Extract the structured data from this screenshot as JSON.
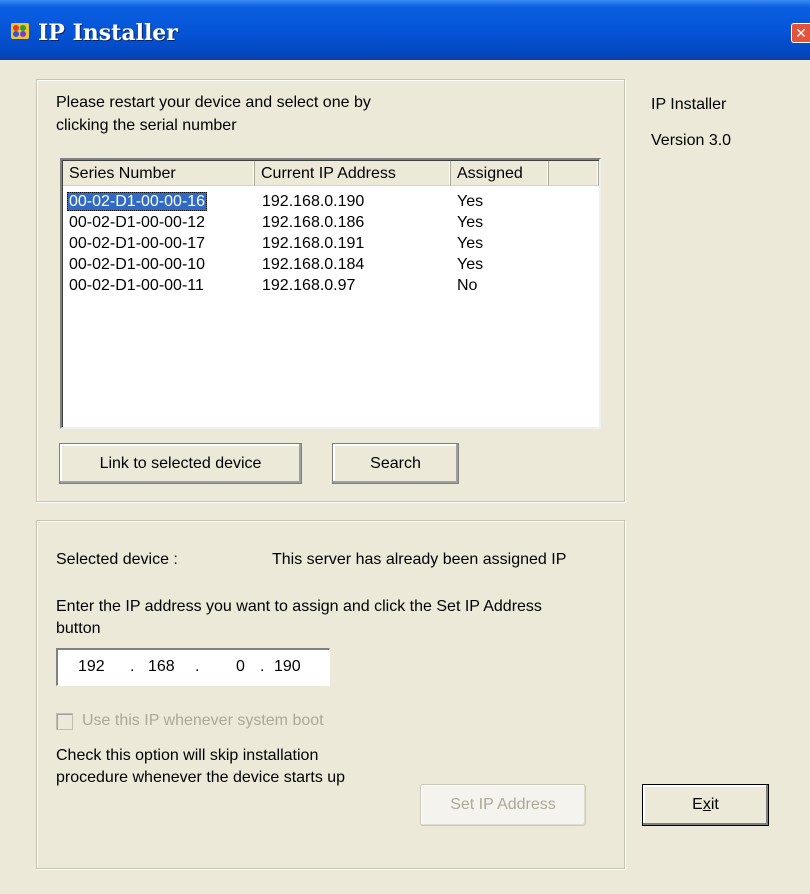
{
  "window": {
    "title": "IP Installer",
    "close_glyph": "✕",
    "icon": "app-icon"
  },
  "right_panel": {
    "product": "IP Installer",
    "version": "Version 3.0"
  },
  "device_group": {
    "instruction_line1": "Please restart your device and select one by",
    "instruction_line2": "clicking the serial number",
    "columns": [
      "Series Number",
      "Current IP Address",
      "Assigned"
    ],
    "rows": [
      {
        "serial": "00-02-D1-00-00-16",
        "ip": "192.168.0.190",
        "assigned": "Yes",
        "selected": true
      },
      {
        "serial": "00-02-D1-00-00-12",
        "ip": "192.168.0.186",
        "assigned": "Yes",
        "selected": false
      },
      {
        "serial": "00-02-D1-00-00-17",
        "ip": "192.168.0.191",
        "assigned": "Yes",
        "selected": false
      },
      {
        "serial": "00-02-D1-00-00-10",
        "ip": "192.168.0.184",
        "assigned": "Yes",
        "selected": false
      },
      {
        "serial": "00-02-D1-00-00-11",
        "ip": "192.168.0.97",
        "assigned": "No",
        "selected": false
      }
    ],
    "link_button": "Link to selected device",
    "search_button": "Search"
  },
  "assign_group": {
    "selected_label": "Selected device :",
    "selected_status": "This server has already been assigned IP",
    "prompt_line1": "Enter the IP address you want to assign and click the Set IP Address",
    "prompt_line2": "button",
    "ip_octets": [
      "192",
      "168",
      "0",
      "190"
    ],
    "ip_dot": ".",
    "boot_checkbox_label": "Use this IP whenever system boot",
    "boot_checkbox_checked": false,
    "note_line1": "Check this option will skip installation",
    "note_line2": "procedure whenever the device starts up",
    "set_ip_button": "Set IP Address"
  },
  "exit_button": {
    "label_before": "E",
    "label_mnemonic": "x",
    "label_after": "it"
  },
  "colors": {
    "titlebar": "#0655d8",
    "selection": "#316ac5",
    "window_bg": "#ece9d8"
  }
}
